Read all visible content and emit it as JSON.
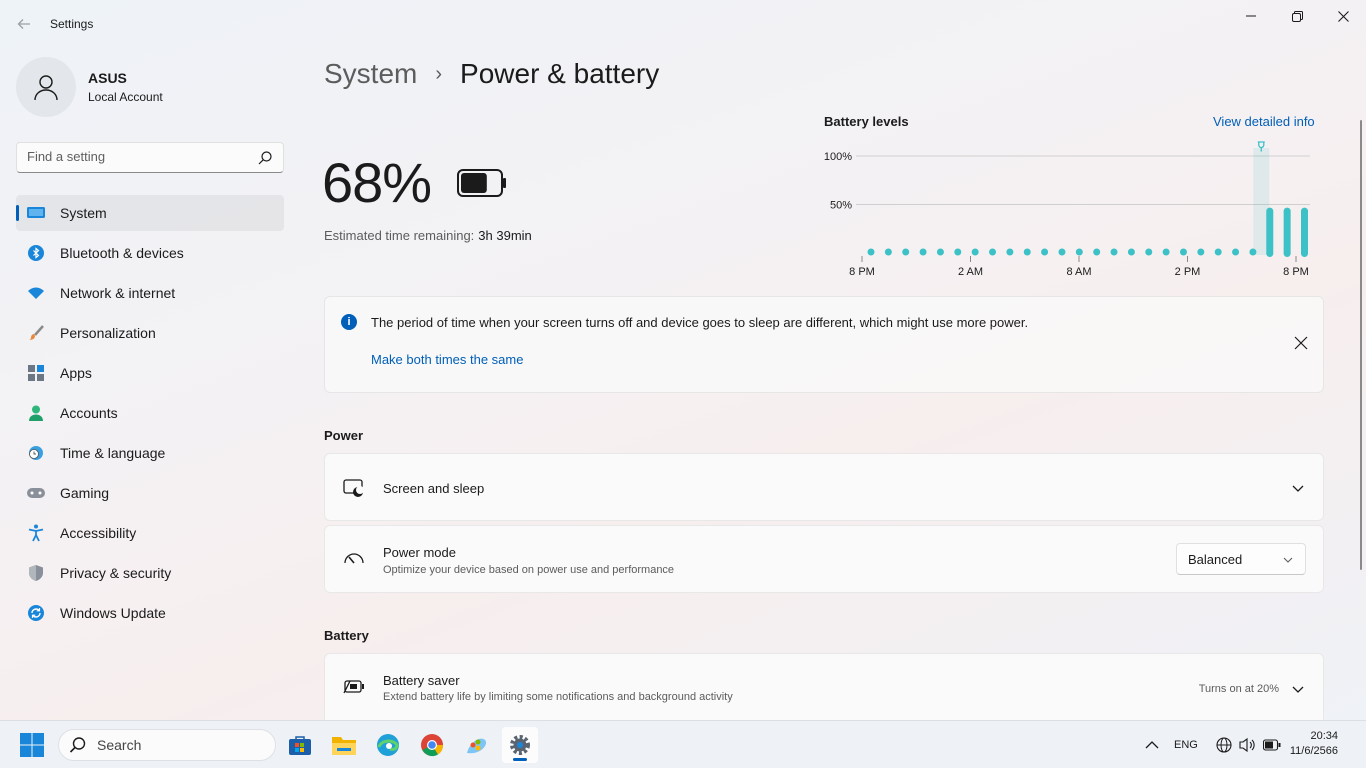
{
  "window": {
    "title": "Settings"
  },
  "profile": {
    "name": "ASUS",
    "account_type": "Local Account"
  },
  "search": {
    "placeholder": "Find a setting"
  },
  "sidebar": {
    "items": [
      {
        "label": "System",
        "icon": "monitor-icon",
        "active": true
      },
      {
        "label": "Bluetooth & devices",
        "icon": "bluetooth-icon"
      },
      {
        "label": "Network & internet",
        "icon": "wifi-icon"
      },
      {
        "label": "Personalization",
        "icon": "brush-icon"
      },
      {
        "label": "Apps",
        "icon": "apps-icon"
      },
      {
        "label": "Accounts",
        "icon": "person-icon"
      },
      {
        "label": "Time & language",
        "icon": "globe-clock-icon"
      },
      {
        "label": "Gaming",
        "icon": "gamepad-icon"
      },
      {
        "label": "Accessibility",
        "icon": "accessibility-icon"
      },
      {
        "label": "Privacy & security",
        "icon": "shield-icon"
      },
      {
        "label": "Windows Update",
        "icon": "update-icon"
      }
    ]
  },
  "breadcrumb": {
    "parent": "System",
    "separator": "›",
    "current": "Power & battery"
  },
  "battery": {
    "percent_label": "68%",
    "level": 0.68,
    "estimate_label": "Estimated time remaining:",
    "estimate_value": "3h 39min"
  },
  "battery_levels": {
    "title": "Battery levels",
    "link": "View detailed info"
  },
  "chart_data": {
    "type": "bar",
    "title": "",
    "y_ticks": [
      "100%",
      "50%"
    ],
    "x_ticks": [
      "8 PM",
      "2 AM",
      "8 AM",
      "2 PM",
      "8 PM"
    ],
    "ylim": [
      0,
      100
    ],
    "values": [
      0,
      0,
      0,
      0,
      0,
      0,
      0,
      0,
      0,
      0,
      0,
      0,
      0,
      0,
      0,
      0,
      0,
      0,
      0,
      0,
      0,
      0,
      0,
      55,
      55,
      55
    ],
    "charging_index": 23
  },
  "info_bar": {
    "message": "The period of time when your screen turns off and device goes to sleep are different, which might use more power.",
    "link": "Make both times the same"
  },
  "power": {
    "section_title": "Power",
    "screen_sleep": {
      "title": "Screen and sleep"
    },
    "power_mode": {
      "title": "Power mode",
      "subtitle": "Optimize your device based on power use and performance",
      "selected": "Balanced"
    }
  },
  "battery_section": {
    "section_title": "Battery",
    "battery_saver": {
      "title": "Battery saver",
      "subtitle": "Extend battery life by limiting some notifications and background activity",
      "status": "Turns on at 20%"
    }
  },
  "taskbar": {
    "search_label": "Search",
    "language": "ENG",
    "time": "20:34",
    "date": "11/6/2566"
  },
  "colors": {
    "accent": "#005fb8",
    "chart": "#3cc1c7"
  }
}
